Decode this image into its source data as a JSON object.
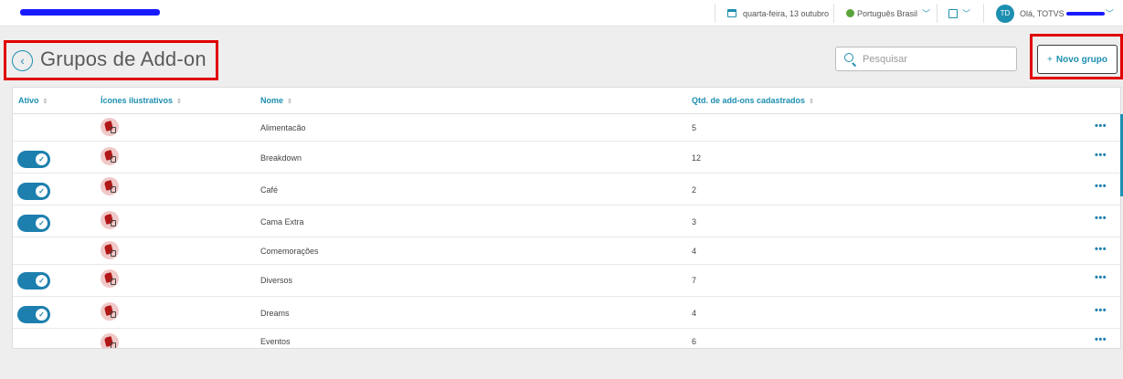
{
  "topbar": {
    "date": "quarta-feira, 13 outubro",
    "language": "Português Brasil",
    "user_initials": "TD",
    "greeting": "Olá, TOTVS"
  },
  "header": {
    "title": "Grupos de Add-on",
    "back_glyph": "‹",
    "search_placeholder": "Pesquisar",
    "new_button_plus": "+",
    "new_button_label": "Novo grupo"
  },
  "table": {
    "columns": [
      "Ativo",
      "Ícones ilustrativos",
      "Nome",
      "Qtd. de add-ons cadastrados"
    ],
    "sort_glyph": "⇕",
    "more_glyph": "•••",
    "rows": [
      {
        "active": false,
        "name": "Alimentacão",
        "count": "5"
      },
      {
        "active": true,
        "name": "Breakdown",
        "count": "12"
      },
      {
        "active": true,
        "name": "Café",
        "count": "2"
      },
      {
        "active": true,
        "name": "Cama Extra",
        "count": "3"
      },
      {
        "active": false,
        "name": "Comemorações",
        "count": "4"
      },
      {
        "active": true,
        "name": "Diversos",
        "count": "7"
      },
      {
        "active": true,
        "name": "Dreams",
        "count": "4"
      },
      {
        "active": false,
        "name": "Eventos",
        "count": "6"
      }
    ]
  },
  "colors": {
    "accent": "#1d8fb0",
    "highlight": "#e00000",
    "toggle_on": "#1d7fae"
  },
  "icons": {
    "row_icon": "illustrative-addon-icon",
    "toggle_check": "✓"
  }
}
